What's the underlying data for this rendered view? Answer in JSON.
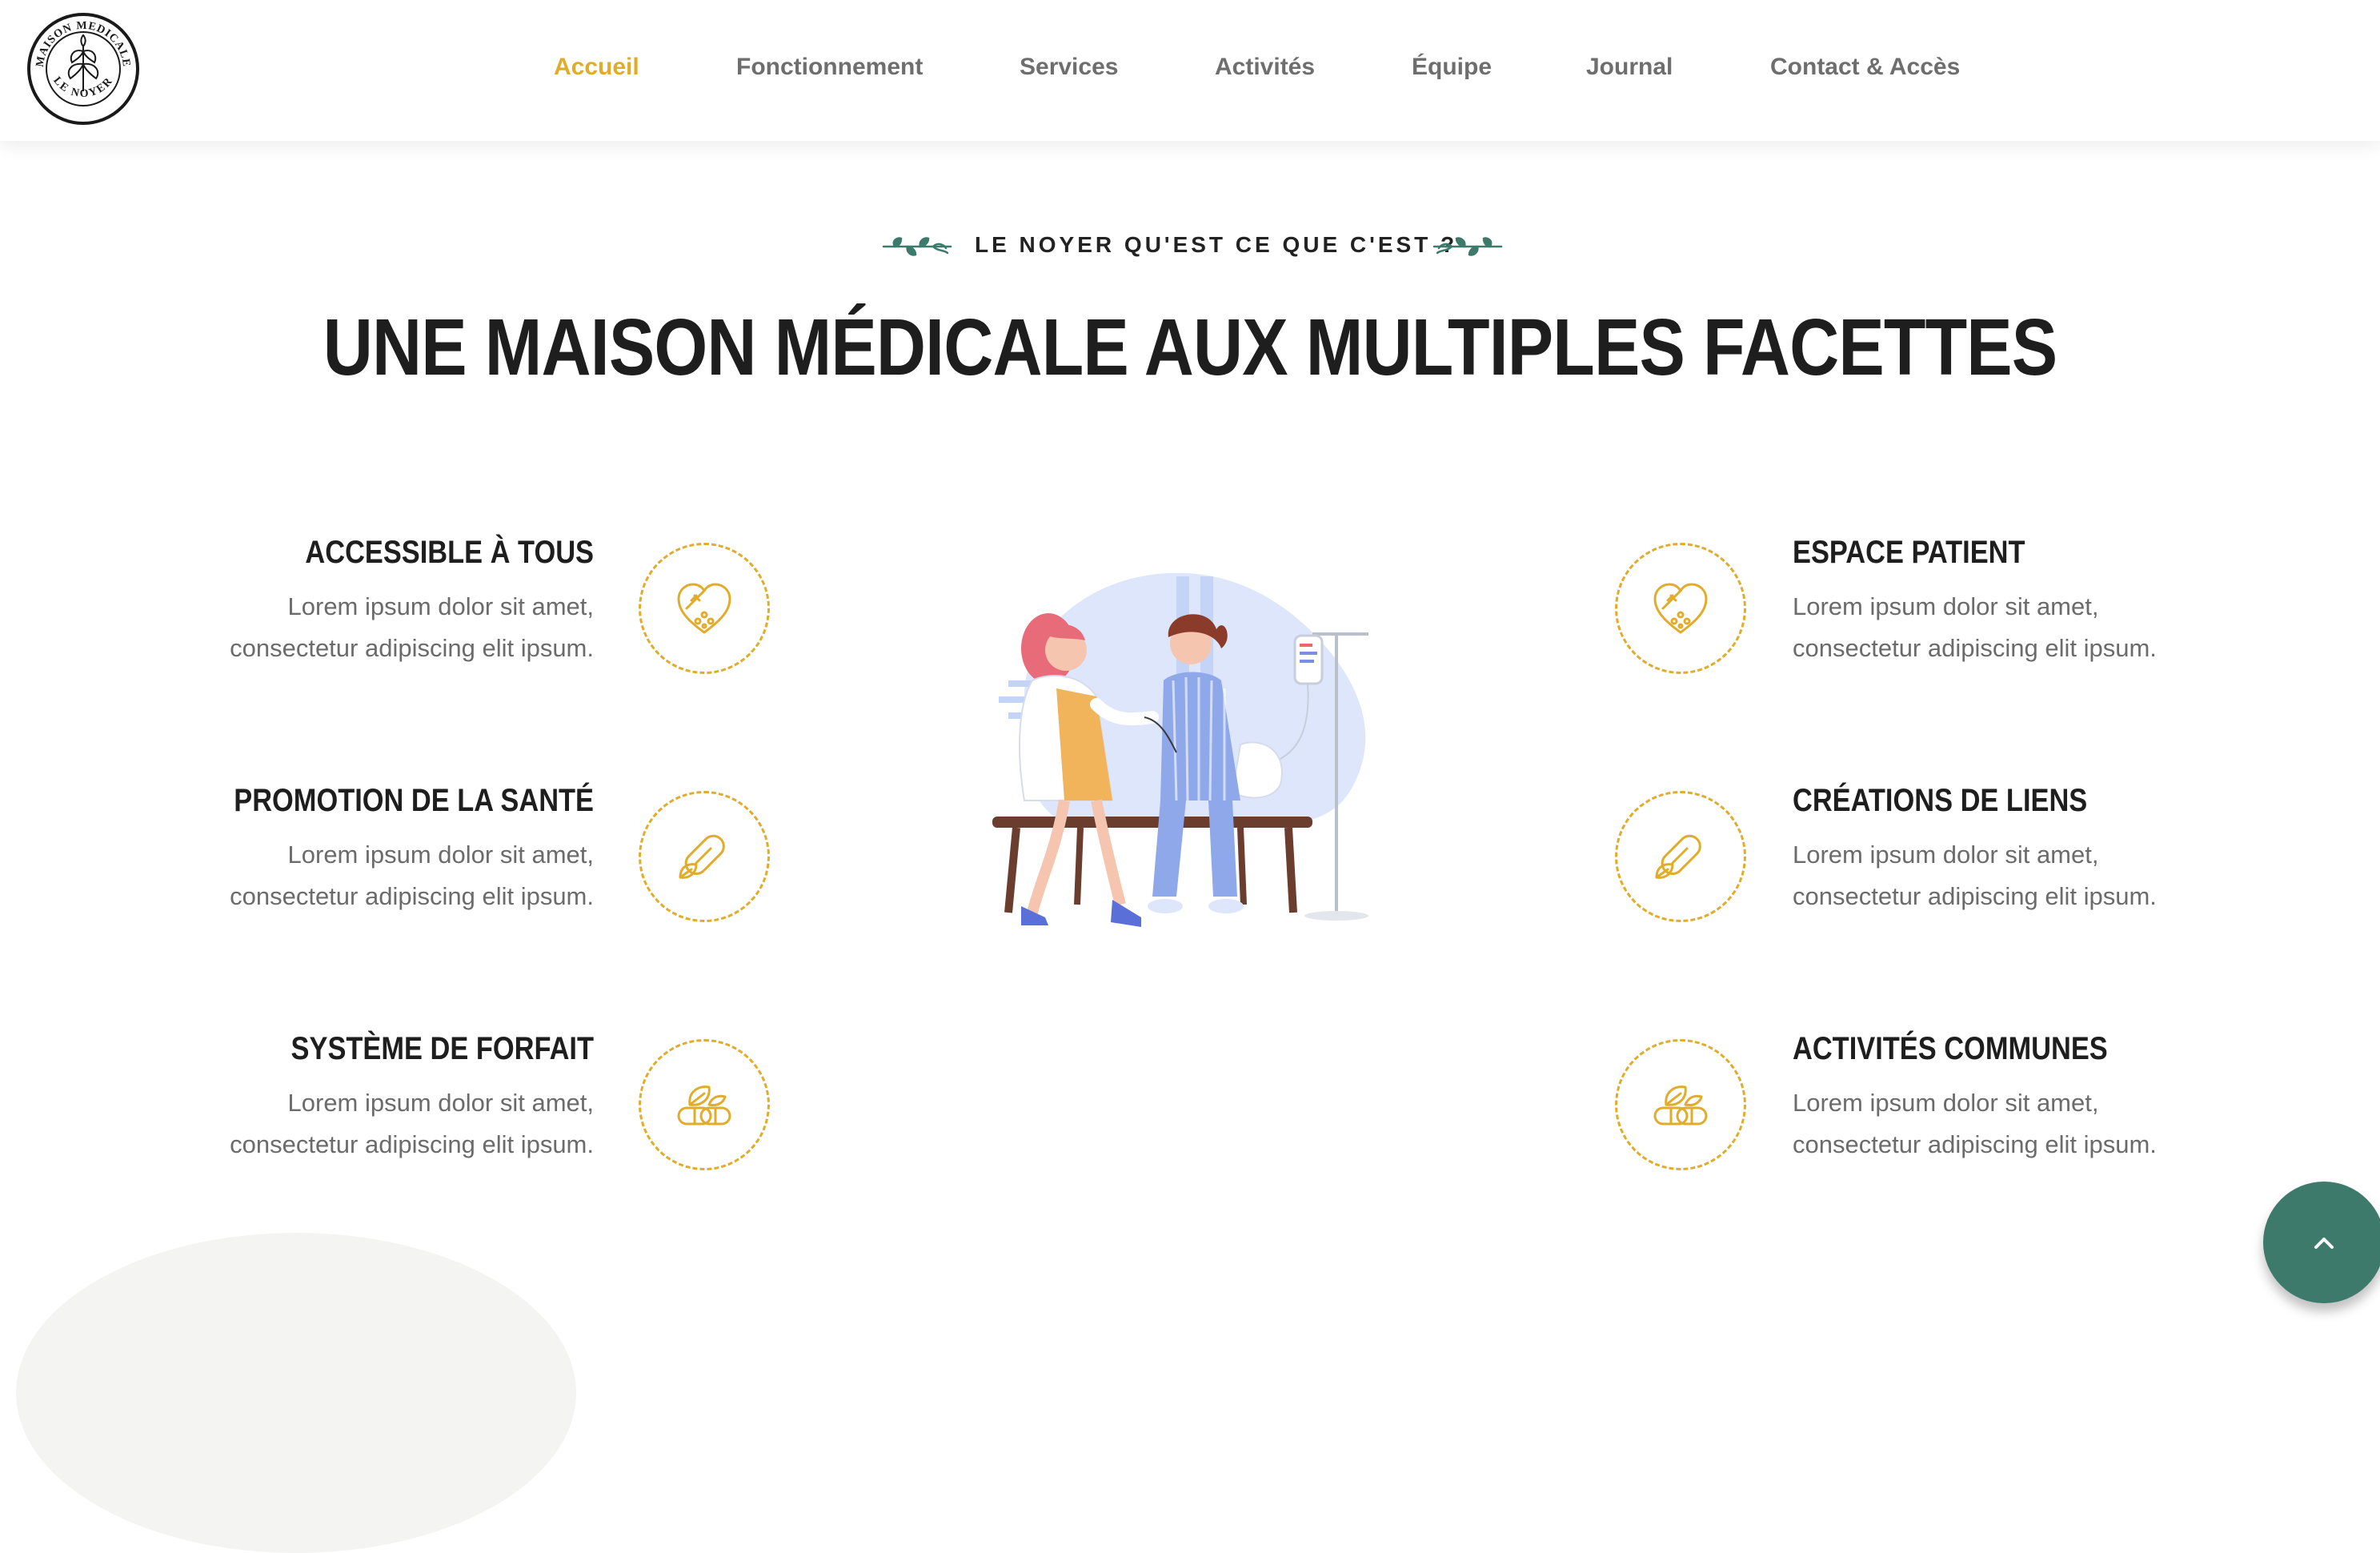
{
  "header": {
    "logo": {
      "text_top": "MAISON MEDICALE",
      "text_bottom": "LE NOYER",
      "icon": "walnut-leaf-icon"
    },
    "nav": [
      {
        "label": "Accueil",
        "active": true
      },
      {
        "label": "Fonctionnement",
        "active": false
      },
      {
        "label": "Services",
        "active": false
      },
      {
        "label": "Activités",
        "active": false
      },
      {
        "label": "Équipe",
        "active": false
      },
      {
        "label": "Journal",
        "active": false
      },
      {
        "label": "Contact & Accès",
        "active": false
      }
    ]
  },
  "intro": {
    "kicker": "LE NOYER QU'EST CE QUE C'EST ?",
    "title": "UNE MAISON MÉDICALE AUX MULTIPLES FACETTES"
  },
  "features_left": [
    {
      "title": "ACCESSIBLE À TOUS",
      "line1": "Lorem ipsum dolor sit amet,",
      "line2": "consectetur adipiscing elit ipsum.",
      "icon": "capsule-heart-icon"
    },
    {
      "title": "PROMOTION DE LA SANTÉ",
      "line1": "Lorem ipsum dolor sit amet,",
      "line2": "consectetur adipiscing elit ipsum.",
      "icon": "capsule-leaf-icon"
    },
    {
      "title": "SYSTÈME DE FORFAIT",
      "line1": "Lorem ipsum dolor sit amet,",
      "line2": "consectetur adipiscing elit ipsum.",
      "icon": "pills-leaf-icon"
    }
  ],
  "features_right": [
    {
      "title": "ESPACE PATIENT",
      "line1": "Lorem ipsum dolor sit amet,",
      "line2": "consectetur adipiscing elit ipsum.",
      "icon": "capsule-heart-icon"
    },
    {
      "title": "CRÉATIONS DE LIENS",
      "line1": "Lorem ipsum dolor sit amet,",
      "line2": "consectetur adipiscing elit ipsum.",
      "icon": "capsule-leaf-icon"
    },
    {
      "title": "ACTIVITÉS COMMUNES",
      "line1": "Lorem ipsum dolor sit amet,",
      "line2": "consectetur adipiscing elit ipsum.",
      "icon": "pills-leaf-icon"
    }
  ],
  "colors": {
    "accent": "#e2ac2b",
    "nav_text": "#6e6e6e",
    "heading": "#1e1e1e",
    "body_text": "#6b6b6b",
    "scroll_button": "#3d7a6c",
    "leaf": "#3d7a6c"
  },
  "scroll_top": {
    "icon": "chevron-up-icon"
  }
}
